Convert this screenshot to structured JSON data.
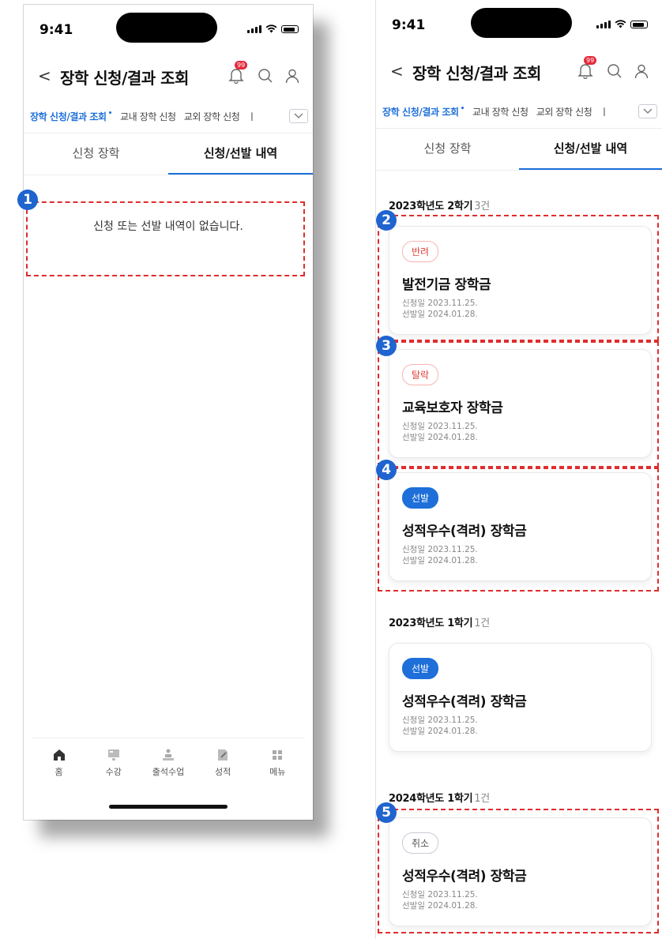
{
  "status": {
    "time": "9:41"
  },
  "nav": {
    "back": "<",
    "title": "장학 신청/결과 조회",
    "badge": "99"
  },
  "subtabs": [
    "장학 신청/결과 조회",
    "교내 장학 신청",
    "교외 장학 신청",
    "ㅣ"
  ],
  "tabs": [
    "신청 장학",
    "신청/선발 내역"
  ],
  "empty_message": "신청 또는 선발 내역이 없습니다.",
  "bottom_nav": [
    "홈",
    "수강",
    "출석수업",
    "성적",
    "메뉴"
  ],
  "sections": [
    {
      "title": "2023학년도 2학기",
      "count": "3건",
      "cards": [
        {
          "status": "반려",
          "status_kind": "reject",
          "name": "발전기금 장학금",
          "applied": "신청일 2023.11.25.",
          "selected": "선발일 2024.01.28."
        },
        {
          "status": "탈락",
          "status_kind": "fail",
          "name": "교육보호자 장학금",
          "applied": "신청일 2023.11.25.",
          "selected": "선발일 2024.01.28."
        },
        {
          "status": "선발",
          "status_kind": "select",
          "name": "성적우수(격려) 장학금",
          "applied": "신청일 2023.11.25.",
          "selected": "선발일 2024.01.28."
        }
      ]
    },
    {
      "title": "2023학년도 1학기",
      "count": "1건",
      "cards": [
        {
          "status": "선발",
          "status_kind": "select",
          "name": "성적우수(격려) 장학금",
          "applied": "신청일 2023.11.25.",
          "selected": "선발일 2024.01.28."
        }
      ]
    },
    {
      "title": "2024학년도 1학기",
      "count": "1건",
      "cards": [
        {
          "status": "취소",
          "status_kind": "cancel",
          "name": "성적우수(격려) 장학금",
          "applied": "신청일 2023.11.25.",
          "selected": "선발일 2024.01.28."
        }
      ]
    }
  ],
  "markers": [
    "1",
    "2",
    "3",
    "4",
    "5"
  ],
  "colors": {
    "accent": "#1e6fd9",
    "annotation": "#e12c2c",
    "marker": "#1f64cf",
    "reject": "#e0403a"
  }
}
